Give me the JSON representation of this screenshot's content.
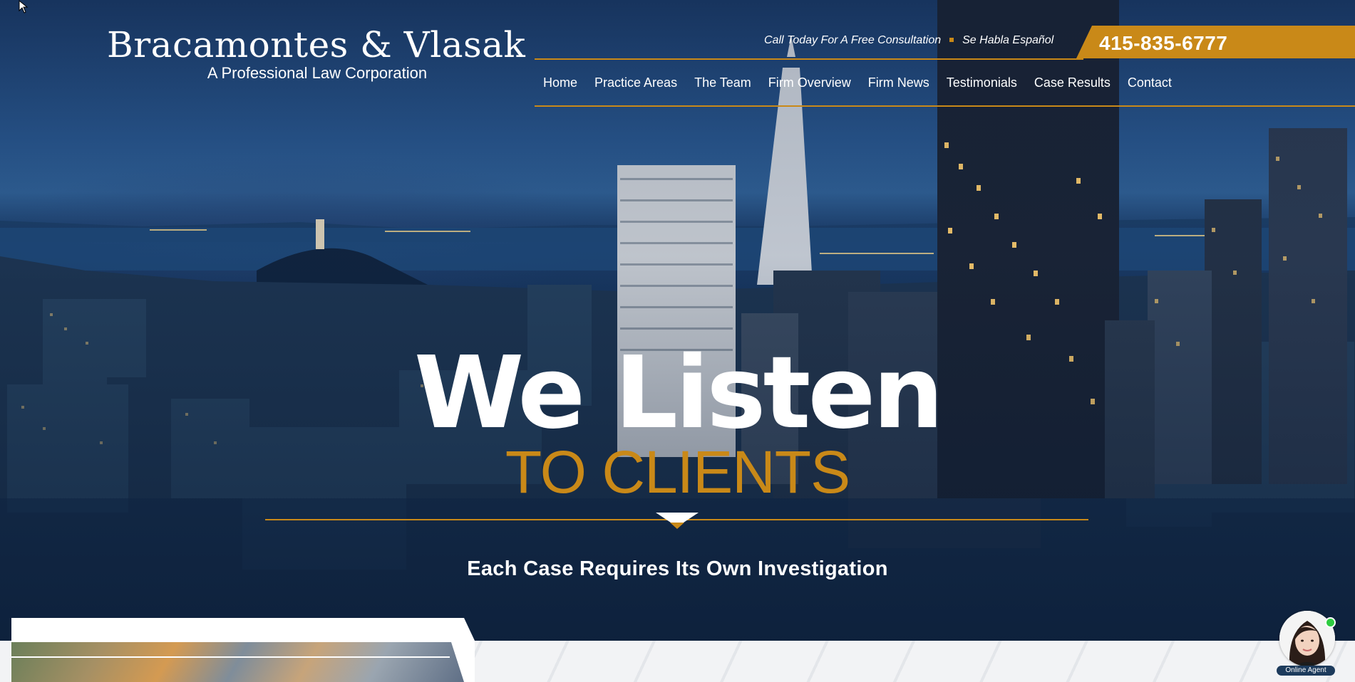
{
  "logo": {
    "name": "Bracamontes & Vlasak",
    "subtitle": "A Professional Law Corporation"
  },
  "topbar": {
    "consultation": "Call Today For A Free Consultation",
    "spanish": "Se Habla Español",
    "phone": "415-835-6777"
  },
  "nav": {
    "items": [
      "Home",
      "Practice Areas",
      "The Team",
      "Firm Overview",
      "Firm News",
      "Testimonials",
      "Case Results",
      "Contact"
    ]
  },
  "hero": {
    "headline": "We Listen",
    "subheadline": "TO CLIENTS",
    "tagline": "Each Case Requires Its Own Investigation"
  },
  "chat": {
    "label": "Online Agent"
  },
  "colors": {
    "accent": "#c98918",
    "navy": "#0c2546"
  }
}
